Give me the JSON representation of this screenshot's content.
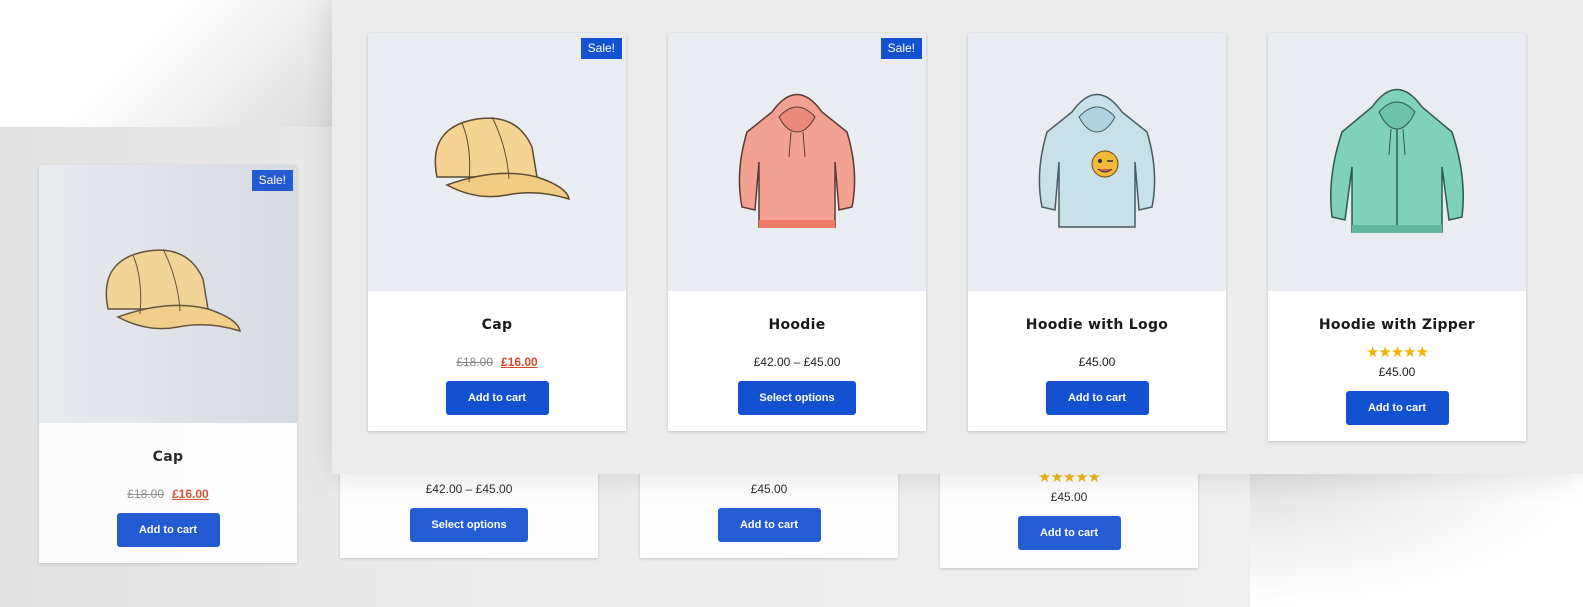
{
  "sale_badge": "Sale!",
  "products": [
    {
      "title": "Cap",
      "price_old": "£18.00",
      "price_new": "£16.00",
      "button": "Add to cart",
      "sale": true
    },
    {
      "title": "Hoodie",
      "price": "£42.00 – £45.00",
      "button": "Select options",
      "sale": true
    },
    {
      "title": "Hoodie with Logo",
      "price": "£45.00",
      "button": "Add to cart",
      "sale": false
    },
    {
      "title": "Hoodie with Zipper",
      "price": "£45.00",
      "button": "Add to cart",
      "sale": false,
      "rating": "★★★★★",
      "rating_value": 5
    }
  ],
  "colors": {
    "accent": "#1450d2",
    "sale_price": "#d24a2a",
    "star": "#f0b400"
  }
}
